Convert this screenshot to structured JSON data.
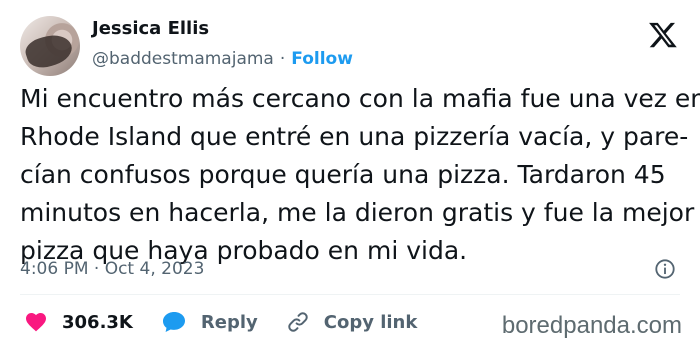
{
  "author": {
    "name": "Jessica Ellis",
    "handle": "@baddestmamajama",
    "separator": "·",
    "follow_label": "Follow"
  },
  "tweet": {
    "lines": [
      "Mi encuentro más cercano con la mafia fue una vez en",
      "Rhode Island que entré en una pizzería vacía, y pare-",
      "cían confusos porque quería una pizza. Tardaron 45",
      "minutos en hacerla, me la dieron gratis y fue la mejor",
      "pizza que haya probado en mi vida."
    ],
    "timestamp": "4:06 PM · Oct 4, 2023"
  },
  "actions": {
    "likes": "306.3K",
    "reply_label": "Reply",
    "copy_link_label": "Copy link"
  },
  "watermark": "boredpanda.com",
  "colors": {
    "text": "#0f1419",
    "secondary": "#536471",
    "link_blue": "#1d9bf0",
    "heart": "#f91880"
  }
}
